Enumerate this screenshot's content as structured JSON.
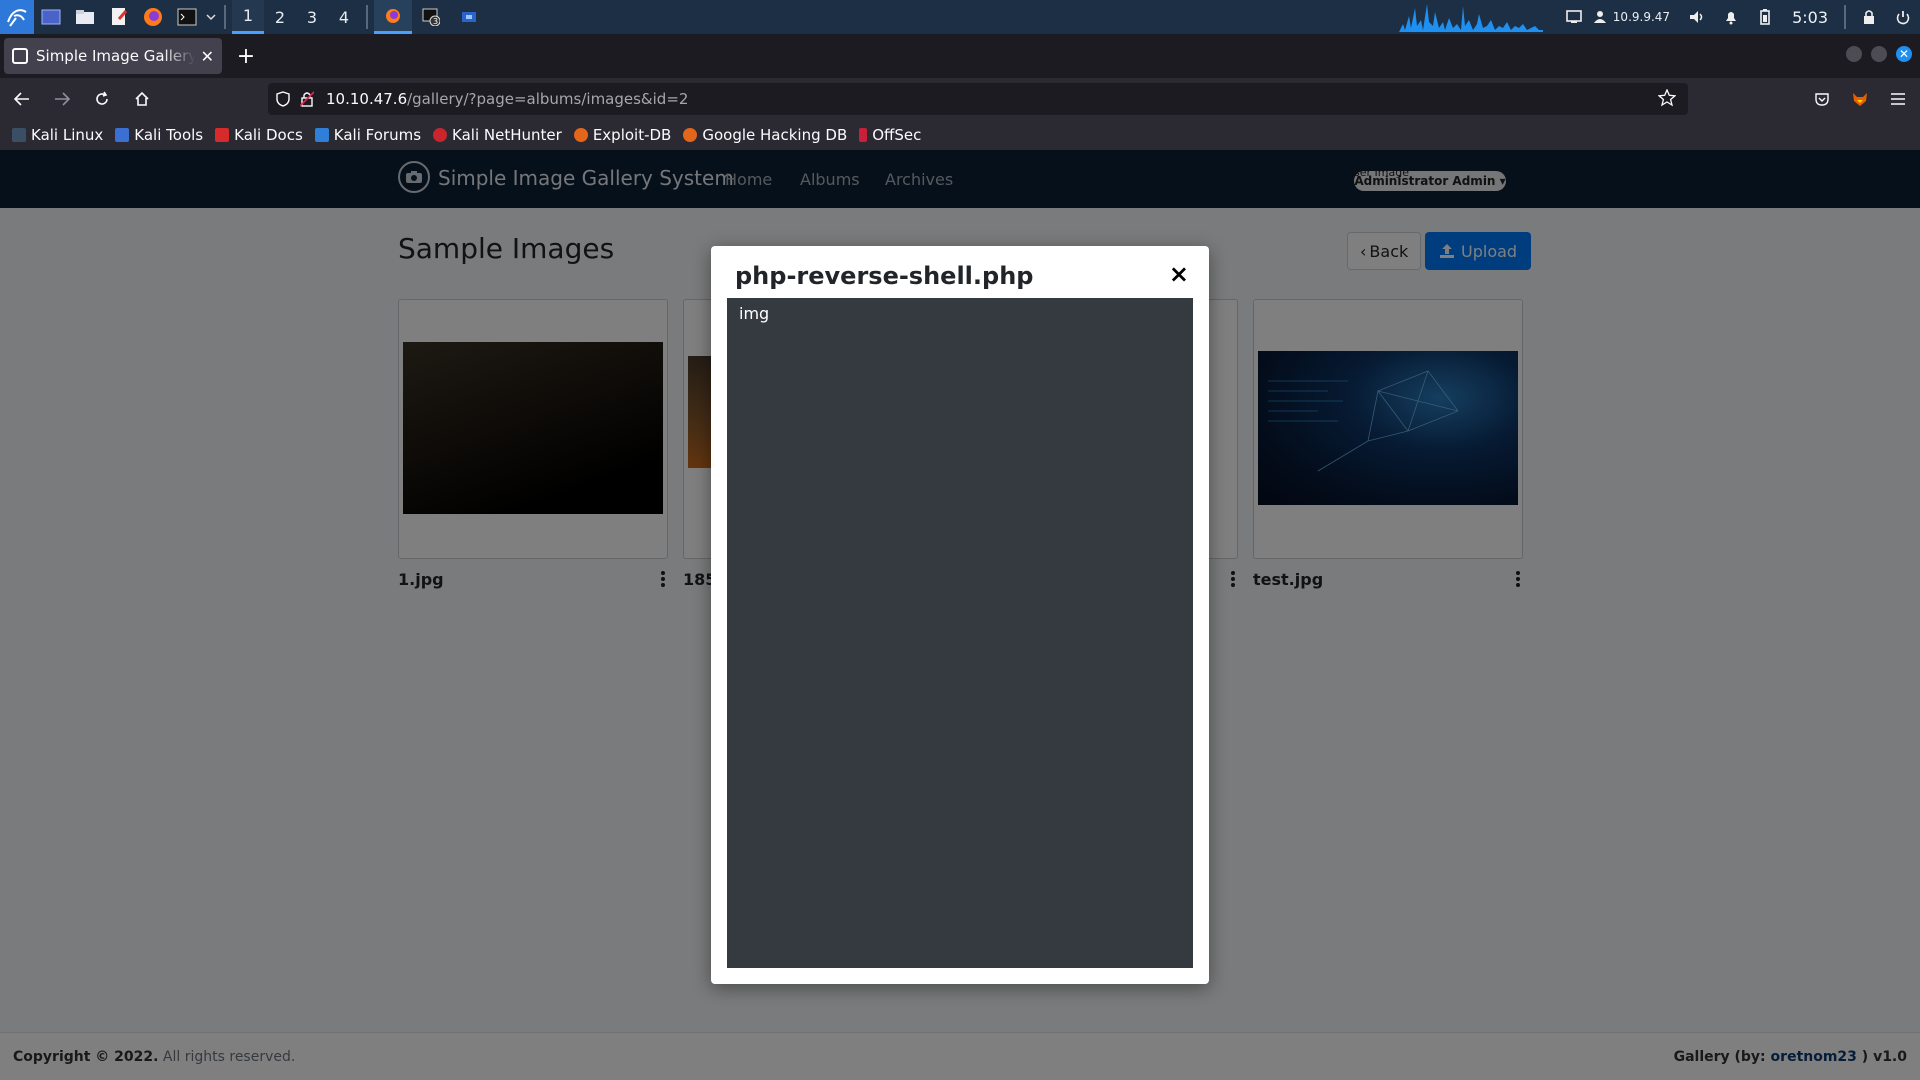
{
  "panel": {
    "workspaces": [
      "1",
      "2",
      "3",
      "4"
    ],
    "ip": "10.9.9.47",
    "clock": "5:03",
    "accent": "#4aa0ff"
  },
  "browser": {
    "tab_title": "Simple Image Gallery System",
    "url_host": "10.10.47.6",
    "url_path": "/gallery/?page=albums/images&id=2",
    "bookmarks": [
      "Kali Linux",
      "Kali Tools",
      "Kali Docs",
      "Kali Forums",
      "Kali NetHunter",
      "Exploit-DB",
      "Google Hacking DB",
      "OffSec"
    ]
  },
  "site": {
    "brand": "Simple Image Gallery System",
    "nav": [
      "Home",
      "Albums",
      "Archives"
    ],
    "user_img_alt": "ser Image",
    "user_label": "Administrator Admin",
    "page_title": "Sample Images",
    "back_label": "Back",
    "upload_label": "Upload",
    "cards": [
      {
        "caption": "1.jpg"
      },
      {
        "caption": "185"
      },
      {
        "caption": ""
      },
      {
        "caption": "test.jpg"
      }
    ],
    "footer_copy": "Copyright © 2022.",
    "footer_rights": "All rights reserved.",
    "footer_by": "Gallery (by: ",
    "footer_author": "oretnom23",
    "footer_version": " ) v1.0"
  },
  "modal": {
    "title": "php-reverse-shell.php",
    "close": "×",
    "body_text": "img"
  }
}
